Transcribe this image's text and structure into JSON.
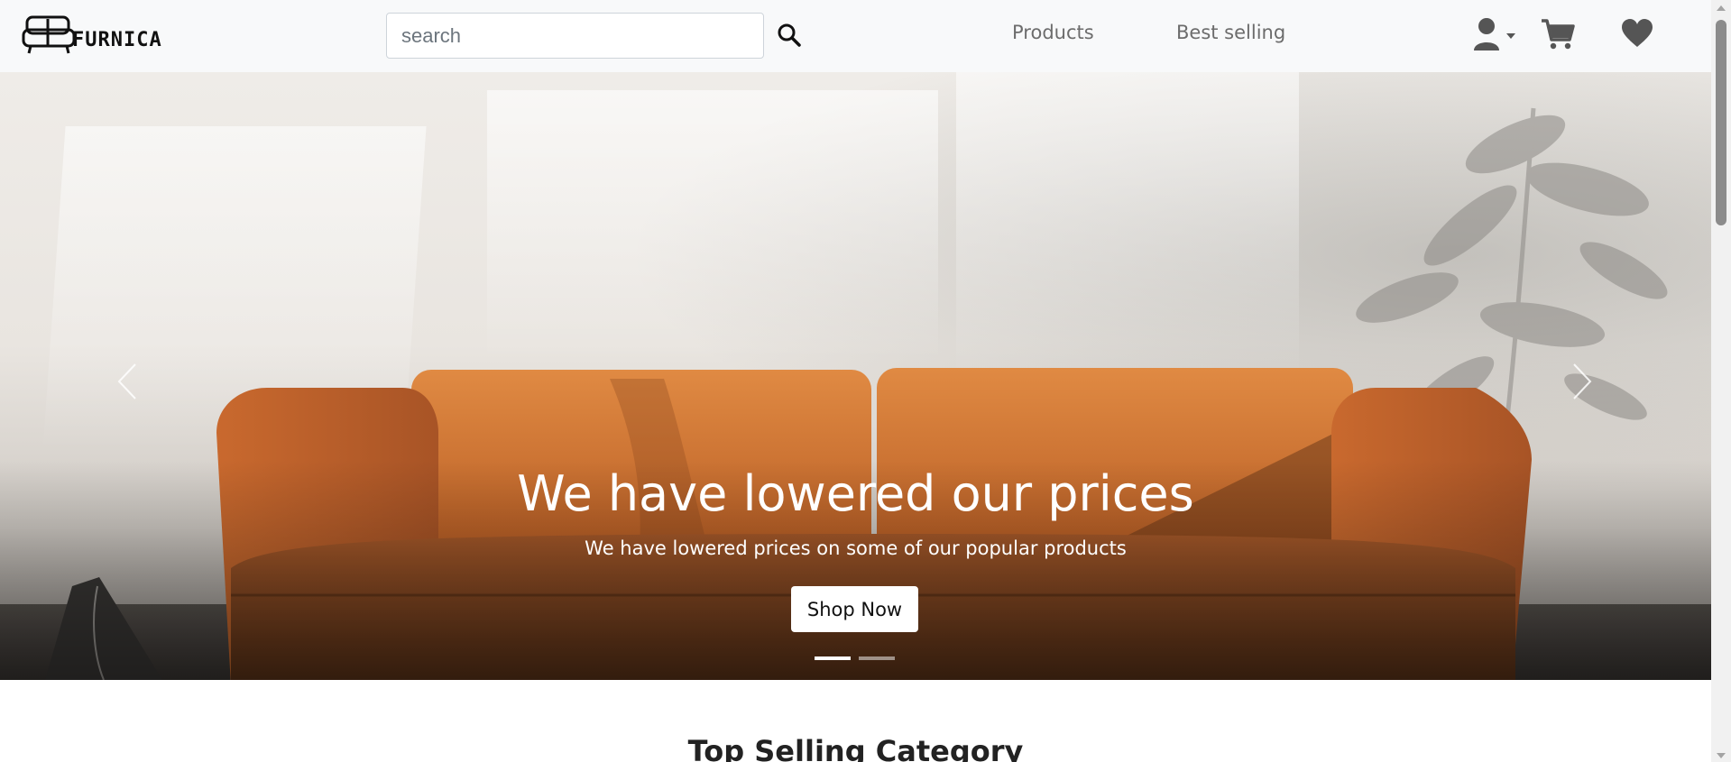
{
  "brand": {
    "name": "FURNICA"
  },
  "search": {
    "placeholder": "search"
  },
  "nav": {
    "links": [
      {
        "label": "Products"
      },
      {
        "label": "Best selling"
      }
    ],
    "icons": [
      "user-icon",
      "caret-down-icon",
      "cart-icon",
      "heart-icon"
    ]
  },
  "hero": {
    "title": "We have lowered our prices",
    "subtitle": "We have lowered prices on some of our popular products",
    "cta_label": "Shop Now",
    "active_slide": 1,
    "slide_count": 2
  },
  "section": {
    "title": "Top Selling Category"
  },
  "colors": {
    "navbar_bg": "#f8f9fa",
    "nav_link": "#6c6c6c",
    "icon": "#555555",
    "sofa": "#c8642a"
  }
}
